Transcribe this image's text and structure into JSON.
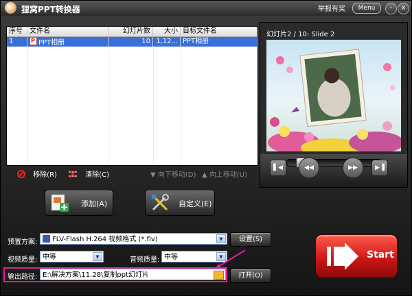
{
  "window": {
    "title": "狸窝PPT转换器",
    "report": "举报有奖",
    "menu": "Menu",
    "minimize": "-",
    "close": "x"
  },
  "file_list": {
    "columns": [
      "序号",
      "文件名",
      "幻灯片数",
      "大小",
      "目标文件名"
    ],
    "rows": [
      {
        "index": "1",
        "file_name": "PPT相册",
        "slides": "10",
        "size": "1,12...",
        "target": "PPT相册"
      }
    ]
  },
  "list_toolbar": {
    "remove": "移除(R)",
    "clear": "清除(C)",
    "move_down": "向下移动(D)",
    "move_up": "向上移动(U)"
  },
  "buttons": {
    "add": "添加(A)",
    "customize": "自定义(E)"
  },
  "preview": {
    "label": "幻灯片2 / 10: Slide 2"
  },
  "settings": {
    "preset_label": "预置方案:",
    "preset_value": "FLV-Flash H.264 视频格式 (*.flv)",
    "preset_button": "设置(S)",
    "video_quality_label": "视频质量:",
    "video_quality_value": "中等",
    "audio_quality_label": "音频质量:",
    "audio_quality_value": "中等",
    "output_label": "输出路径:",
    "output_value": "E:\\解决方案\\11.28\\复制ppt幻灯片",
    "open_button": "打开(O)"
  },
  "start": {
    "label": "Start"
  },
  "colors": {
    "accent": "#e21c9c",
    "start": "#d81e1e",
    "selection": "#3a6fd8"
  }
}
